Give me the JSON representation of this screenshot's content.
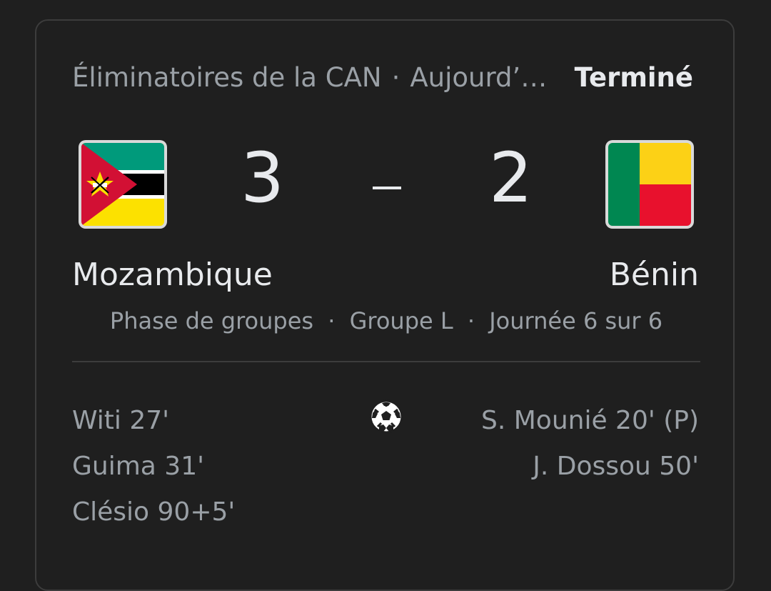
{
  "header": {
    "competition": "Éliminatoires de la CAN",
    "date": "Aujourd’…",
    "separator": "·",
    "status": "Terminé"
  },
  "home": {
    "name": "Mozambique",
    "score": "3",
    "flag": "mozambique-flag",
    "scorers": [
      "Witi 27'",
      "Guima 31'",
      "Clésio 90+5'"
    ]
  },
  "away": {
    "name": "Bénin",
    "score": "2",
    "flag": "benin-flag",
    "scorers": [
      "S. Mounié 20' (P)",
      "J. Dossou 50'"
    ]
  },
  "phase": {
    "stage": "Phase de groupes",
    "group": "Groupe L",
    "matchday": "Journée 6 sur 6",
    "separator": "·"
  },
  "icons": {
    "goal": "soccer-ball-icon"
  },
  "colors": {
    "background": "#1f1f1f",
    "text_primary": "#e8eaed",
    "text_secondary": "#9aa0a6",
    "border": "#3c3c3c"
  }
}
